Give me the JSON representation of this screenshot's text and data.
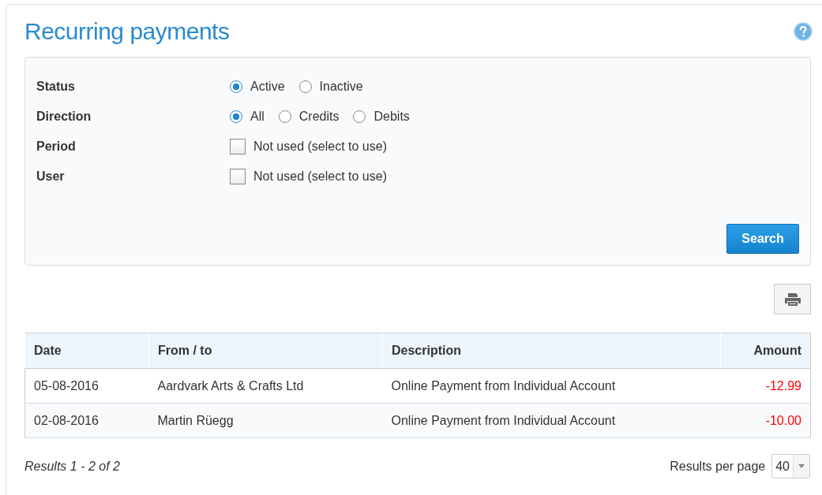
{
  "title": "Recurring payments",
  "filters": [
    {
      "label": "Status",
      "kind": "radio",
      "options": [
        {
          "label": "Active",
          "selected": true
        },
        {
          "label": "Inactive",
          "selected": false
        }
      ]
    },
    {
      "label": "Direction",
      "kind": "radio",
      "options": [
        {
          "label": "All",
          "selected": true
        },
        {
          "label": "Credits",
          "selected": false
        },
        {
          "label": "Debits",
          "selected": false
        }
      ]
    },
    {
      "label": "Period",
      "kind": "checkbox",
      "options": [
        {
          "label": "Not used (select to use)",
          "checked": false
        }
      ]
    },
    {
      "label": "User",
      "kind": "checkbox",
      "options": [
        {
          "label": "Not used (select to use)",
          "checked": false
        }
      ]
    }
  ],
  "search_button": "Search",
  "table": {
    "columns": [
      "Date",
      "From / to",
      "Description",
      "Amount"
    ],
    "rows": [
      {
        "date": "05-08-2016",
        "from_to": "Aardvark Arts & Crafts Ltd",
        "description": "Online Payment from Individual Account",
        "amount": "-12.99",
        "negative": true
      },
      {
        "date": "02-08-2016",
        "from_to": "Martin Rüegg",
        "description": "Online Payment from Individual Account",
        "amount": "-10.00",
        "negative": true
      }
    ]
  },
  "results_summary": "Results 1 - 2 of 2",
  "results_per_page": {
    "label": "Results per page",
    "value": "40"
  }
}
